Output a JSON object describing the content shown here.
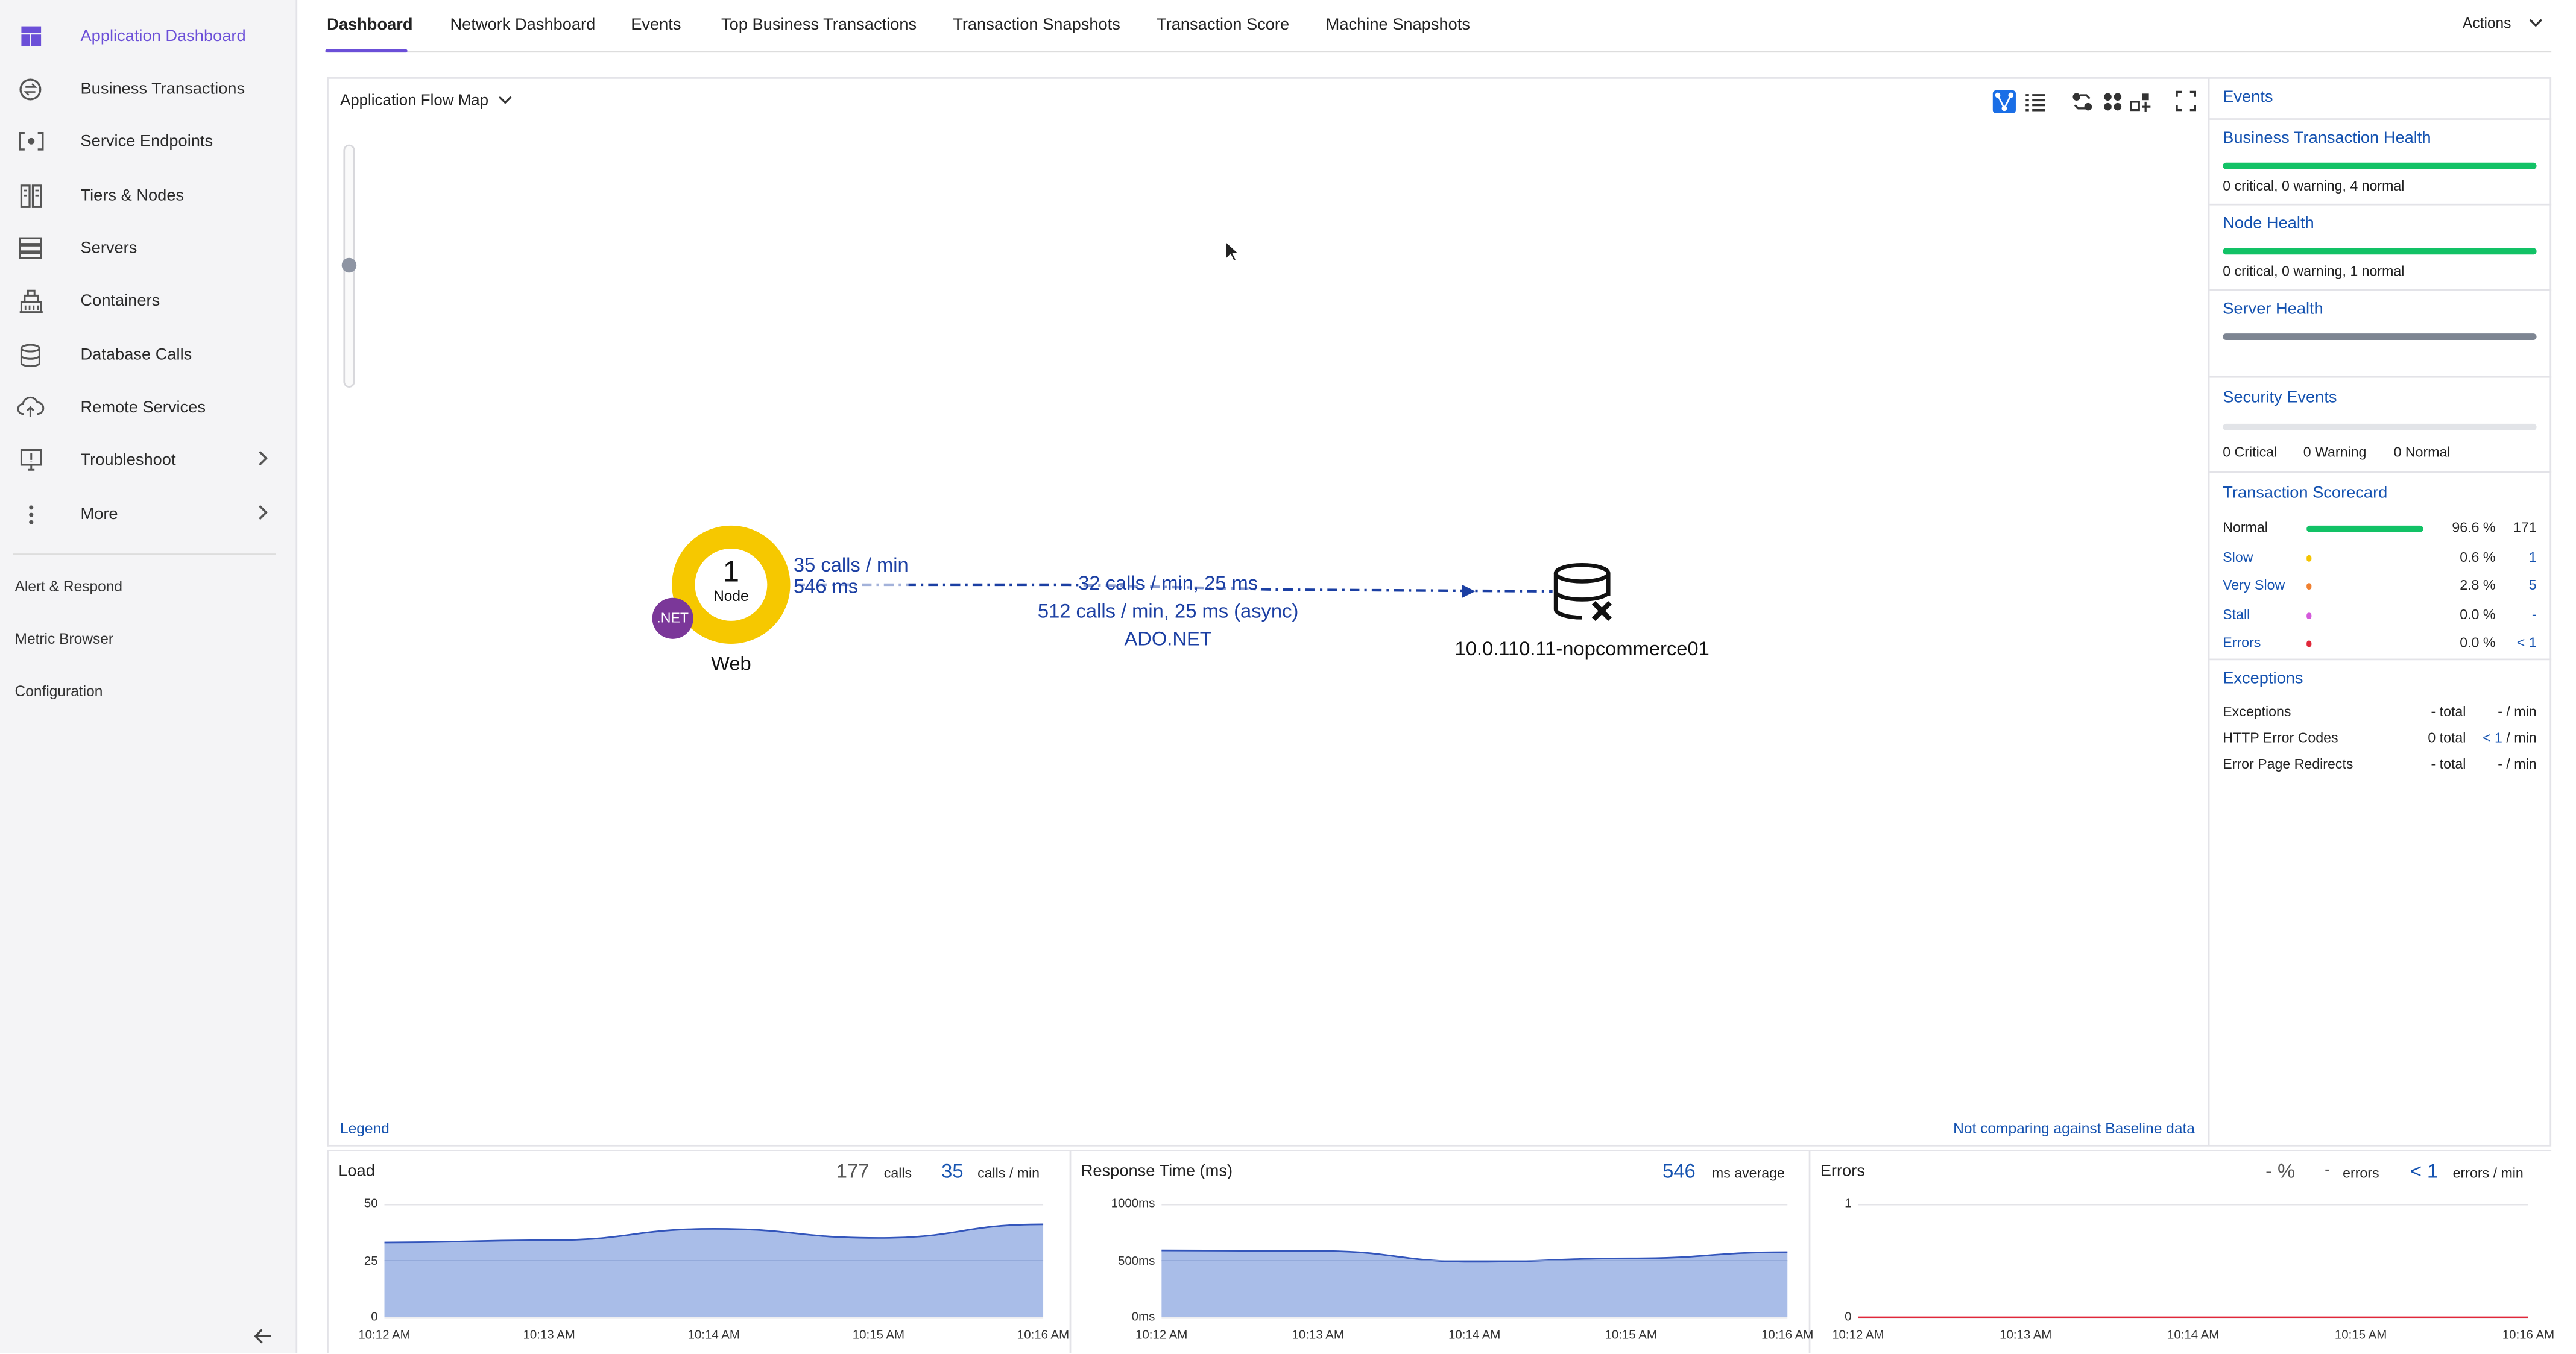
{
  "sidebar": {
    "items": [
      {
        "label": "Application Dashboard"
      },
      {
        "label": "Business Transactions"
      },
      {
        "label": "Service Endpoints"
      },
      {
        "label": "Tiers & Nodes"
      },
      {
        "label": "Servers"
      },
      {
        "label": "Containers"
      },
      {
        "label": "Database Calls"
      },
      {
        "label": "Remote Services"
      },
      {
        "label": "Troubleshoot"
      },
      {
        "label": "More"
      }
    ],
    "links": [
      "Alert & Respond",
      "Metric Browser",
      "Configuration"
    ]
  },
  "tabs": [
    "Dashboard",
    "Network Dashboard",
    "Events",
    "Top Business Transactions",
    "Transaction Snapshots",
    "Transaction Score",
    "Machine Snapshots"
  ],
  "actions_label": "Actions",
  "flowmap": {
    "selector_label": "Application Flow Map",
    "node": {
      "count": "1",
      "type": "Node",
      "name": "Web",
      "badge": ".NET"
    },
    "edge_in": {
      "calls": "35 calls / min",
      "time": "546 ms"
    },
    "edge": {
      "line1": "32 calls / min, 25 ms",
      "line2": "512 calls / min, 25 ms (async)",
      "line3": "ADO.NET"
    },
    "db_name": "10.0.110.11-nopcommerce01",
    "legend": "Legend",
    "baseline": "Not comparing against Baseline data"
  },
  "right": {
    "events": "Events",
    "bt_health": {
      "title": "Business Transaction Health",
      "summary": "0 critical, 0 warning, 4 normal",
      "color": "#12c266"
    },
    "node_health": {
      "title": "Node Health",
      "summary": "0 critical, 0 warning, 1 normal",
      "color": "#12c266"
    },
    "server_health": {
      "title": "Server Health",
      "color": "#7d8592"
    },
    "security": {
      "title": "Security Events",
      "critical": "0 Critical",
      "warning": "0 Warning",
      "normal": "0 Normal"
    },
    "scorecard": {
      "title": "Transaction Scorecard",
      "rows": [
        {
          "label": "Normal",
          "pct": "96.6 %",
          "count": "171",
          "color": "#12c266",
          "fraction": 0.966,
          "link": false
        },
        {
          "label": "Slow",
          "pct": "0.6 %",
          "count": "1",
          "color": "#f5c400",
          "fraction": 0.006,
          "link": true
        },
        {
          "label": "Very Slow",
          "pct": "2.8 %",
          "count": "5",
          "color": "#f08030",
          "fraction": 0.028,
          "link": true
        },
        {
          "label": "Stall",
          "pct": "0.0 %",
          "count": "-",
          "color": "#d45adb",
          "fraction": 0.0,
          "link": true
        },
        {
          "label": "Errors",
          "pct": "0.0 %",
          "count": "< 1",
          "color": "#e0283a",
          "fraction": 0.0,
          "link": true
        }
      ]
    },
    "exceptions": {
      "title": "Exceptions",
      "rows": [
        {
          "label": "Exceptions",
          "total": "- total",
          "rate": "- / min"
        },
        {
          "label": "HTTP Error Codes",
          "total": "0 total",
          "rate_link": "< 1",
          "rate": "/ min"
        },
        {
          "label": "Error Page Redirects",
          "total": "- total",
          "rate": "- / min"
        }
      ]
    }
  },
  "charts": {
    "load": {
      "title": "Load",
      "calls": "177",
      "calls_unit": "calls",
      "rate": "35",
      "rate_unit": "calls / min"
    },
    "response": {
      "title": "Response Time (ms)",
      "avg": "546",
      "avg_unit": "ms average"
    },
    "errors": {
      "title": "Errors",
      "pct": "- %",
      "errors": "-",
      "errors_unit": "errors",
      "rate": "< 1",
      "rate_unit": "errors / min"
    }
  },
  "chart_data": [
    {
      "type": "area",
      "title": "Load",
      "x": [
        "10:12 AM",
        "10:13 AM",
        "10:14 AM",
        "10:15 AM",
        "10:16 AM"
      ],
      "yticks": [
        "50",
        "25",
        "0"
      ],
      "ylim": [
        0,
        50
      ],
      "values": [
        33,
        34,
        39,
        35,
        41
      ]
    },
    {
      "type": "area",
      "title": "Response Time (ms)",
      "x": [
        "10:12 AM",
        "10:13 AM",
        "10:14 AM",
        "10:15 AM",
        "10:16 AM"
      ],
      "yticks": [
        "1000ms",
        "500ms",
        "0ms"
      ],
      "ylim": [
        0,
        1000
      ],
      "values": [
        590,
        585,
        490,
        520,
        575
      ]
    },
    {
      "type": "line",
      "title": "Errors",
      "x": [
        "10:12 AM",
        "10:13 AM",
        "10:14 AM",
        "10:15 AM",
        "10:16 AM"
      ],
      "yticks": [
        "1",
        "0"
      ],
      "ylim": [
        0,
        1
      ],
      "values": [
        0,
        0,
        0,
        0,
        0
      ]
    }
  ]
}
